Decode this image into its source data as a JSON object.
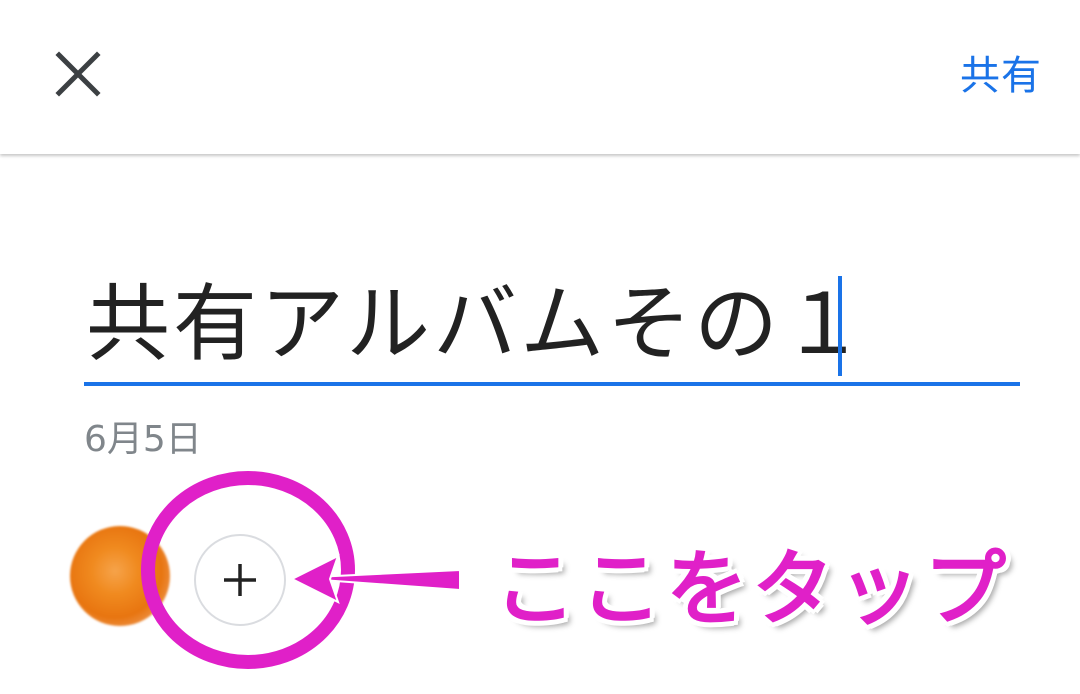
{
  "appbar": {
    "close_icon": "close-icon",
    "share_label": "共有"
  },
  "album": {
    "title": "共有アルバムその１",
    "date": "6月5日"
  },
  "members": {
    "add_icon": "plus-icon"
  },
  "annotation": {
    "label": "ここをタップ",
    "color": "#e020c8"
  },
  "colors": {
    "accent": "#1a73e8",
    "avatar": "#f08a1f"
  }
}
